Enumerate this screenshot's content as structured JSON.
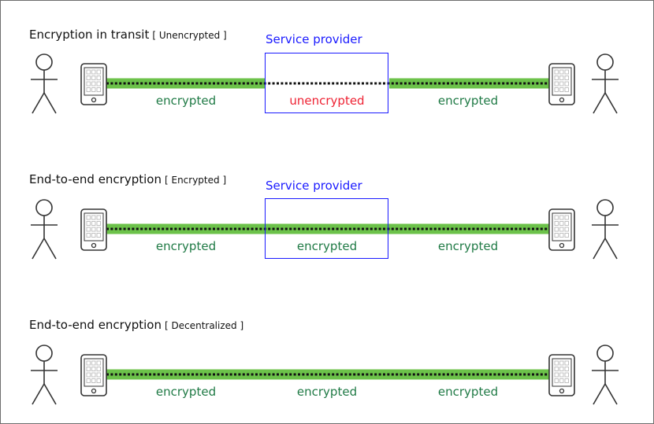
{
  "colors": {
    "encrypted_line": "#6cc24a",
    "dotted_line": "#111111",
    "encrypted_text": "#1f7a45",
    "unencrypted_text": "#ee2233",
    "service_provider": "#1a1aff",
    "icon_stroke": "#333333",
    "phone_grid": "#bbbbbb"
  },
  "rows": [
    {
      "title": "Encryption in transit",
      "tag": "[ Unencrypted ]",
      "service_provider": "Service provider",
      "segments": [
        {
          "label": "encrypted",
          "state": "encrypted"
        },
        {
          "label": "unencrypted",
          "state": "unencrypted"
        },
        {
          "label": "encrypted",
          "state": "encrypted"
        }
      ]
    },
    {
      "title": "End-to-end encryption",
      "tag": "[ Encrypted ]",
      "service_provider": "Service provider",
      "segments": [
        {
          "label": "encrypted",
          "state": "encrypted"
        },
        {
          "label": "encrypted",
          "state": "encrypted"
        },
        {
          "label": "encrypted",
          "state": "encrypted"
        }
      ]
    },
    {
      "title": "End-to-end encryption",
      "tag": "[ Decentralized ]",
      "service_provider": null,
      "segments": [
        {
          "label": "encrypted",
          "state": "encrypted"
        },
        {
          "label": "encrypted",
          "state": "encrypted"
        },
        {
          "label": "encrypted",
          "state": "encrypted"
        }
      ]
    }
  ]
}
